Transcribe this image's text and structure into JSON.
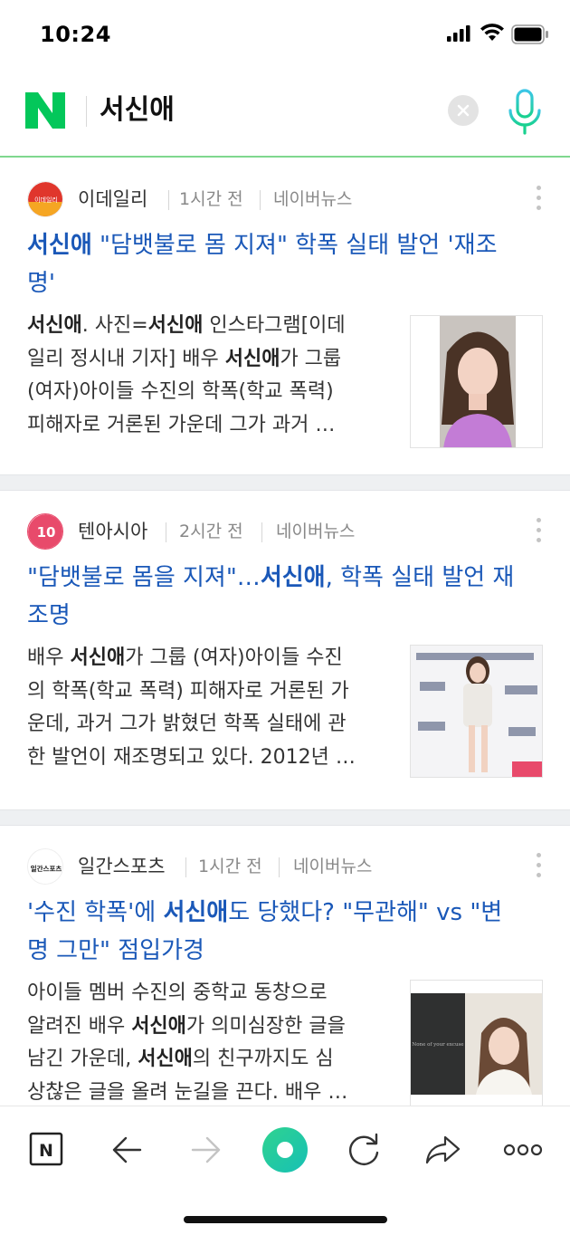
{
  "status_bar": {
    "time": "10:24"
  },
  "search": {
    "query": "서신애"
  },
  "articles": [
    {
      "press": "이데일리",
      "press_logo_text": "이데일리",
      "time": "1시간 전",
      "source": "네이버뉴스",
      "title_parts": [
        "서신애",
        " \"담뱃불로 몸 지져\" 학폭 실태 발언 '재조",
        "명'"
      ],
      "body_lines": [
        [
          [
            "서신애",
            true
          ],
          [
            ". 사진=",
            false
          ],
          [
            "서신애",
            true
          ],
          [
            " 인스타그램[이데",
            false
          ]
        ],
        [
          [
            "일리 정시내 기자] 배우 ",
            false
          ],
          [
            "서신애",
            true
          ],
          [
            "가 그룹",
            false
          ]
        ],
        [
          [
            "(여자)아이들 수진의 학폭(학교 폭력)",
            false
          ]
        ],
        [
          [
            "피해자로 거론된 가운데 그가 과거 …",
            false
          ]
        ]
      ]
    },
    {
      "press": "텐아시아",
      "press_logo_text": "10",
      "time": "2시간 전",
      "source": "네이버뉴스",
      "title_parts": [
        "\"담뱃불로 몸을 지져\"…",
        "서신애",
        ", 학폭 실태 발언 재",
        "조명"
      ],
      "body_lines": [
        [
          [
            "배우 ",
            false
          ],
          [
            "서신애",
            true
          ],
          [
            "가 그룹 (여자)아이들 수진",
            false
          ]
        ],
        [
          [
            "의 학폭(학교 폭력) 피해자로 거론된 가",
            false
          ]
        ],
        [
          [
            "운데, 과거 그가 밝혔던 학폭 실태에 관",
            false
          ]
        ],
        [
          [
            "한 발언이 재조명되고 있다. 2012년 …",
            false
          ]
        ]
      ]
    },
    {
      "press": "일간스포츠",
      "press_logo_text": "일간스포츠",
      "time": "1시간 전",
      "source": "네이버뉴스",
      "title_parts": [
        "'수진 학폭'에 ",
        "서신애",
        "도 당했다? \"무관해\" vs \"변",
        "명 그만\" 점입가경"
      ],
      "body_lines": [
        [
          [
            "아이들 멤버 수진의 중학교 동창으로",
            false
          ]
        ],
        [
          [
            "알려진 배우 ",
            false
          ],
          [
            "서신애",
            true
          ],
          [
            "가 의미심장한 글을",
            false
          ]
        ],
        [
          [
            "남긴 가운데, ",
            false
          ],
          [
            "서신애",
            true
          ],
          [
            "의 친구까지도 심",
            false
          ]
        ],
        [
          [
            "상찮은 글을 올려 눈길을 끈다. 배우 …",
            false
          ]
        ]
      ],
      "thumb_caption": "None of your excuse"
    }
  ],
  "toolbar": {
    "home_label": "N"
  },
  "colors": {
    "accent_green": "#03c75a",
    "link_blue": "#1a58b8"
  }
}
